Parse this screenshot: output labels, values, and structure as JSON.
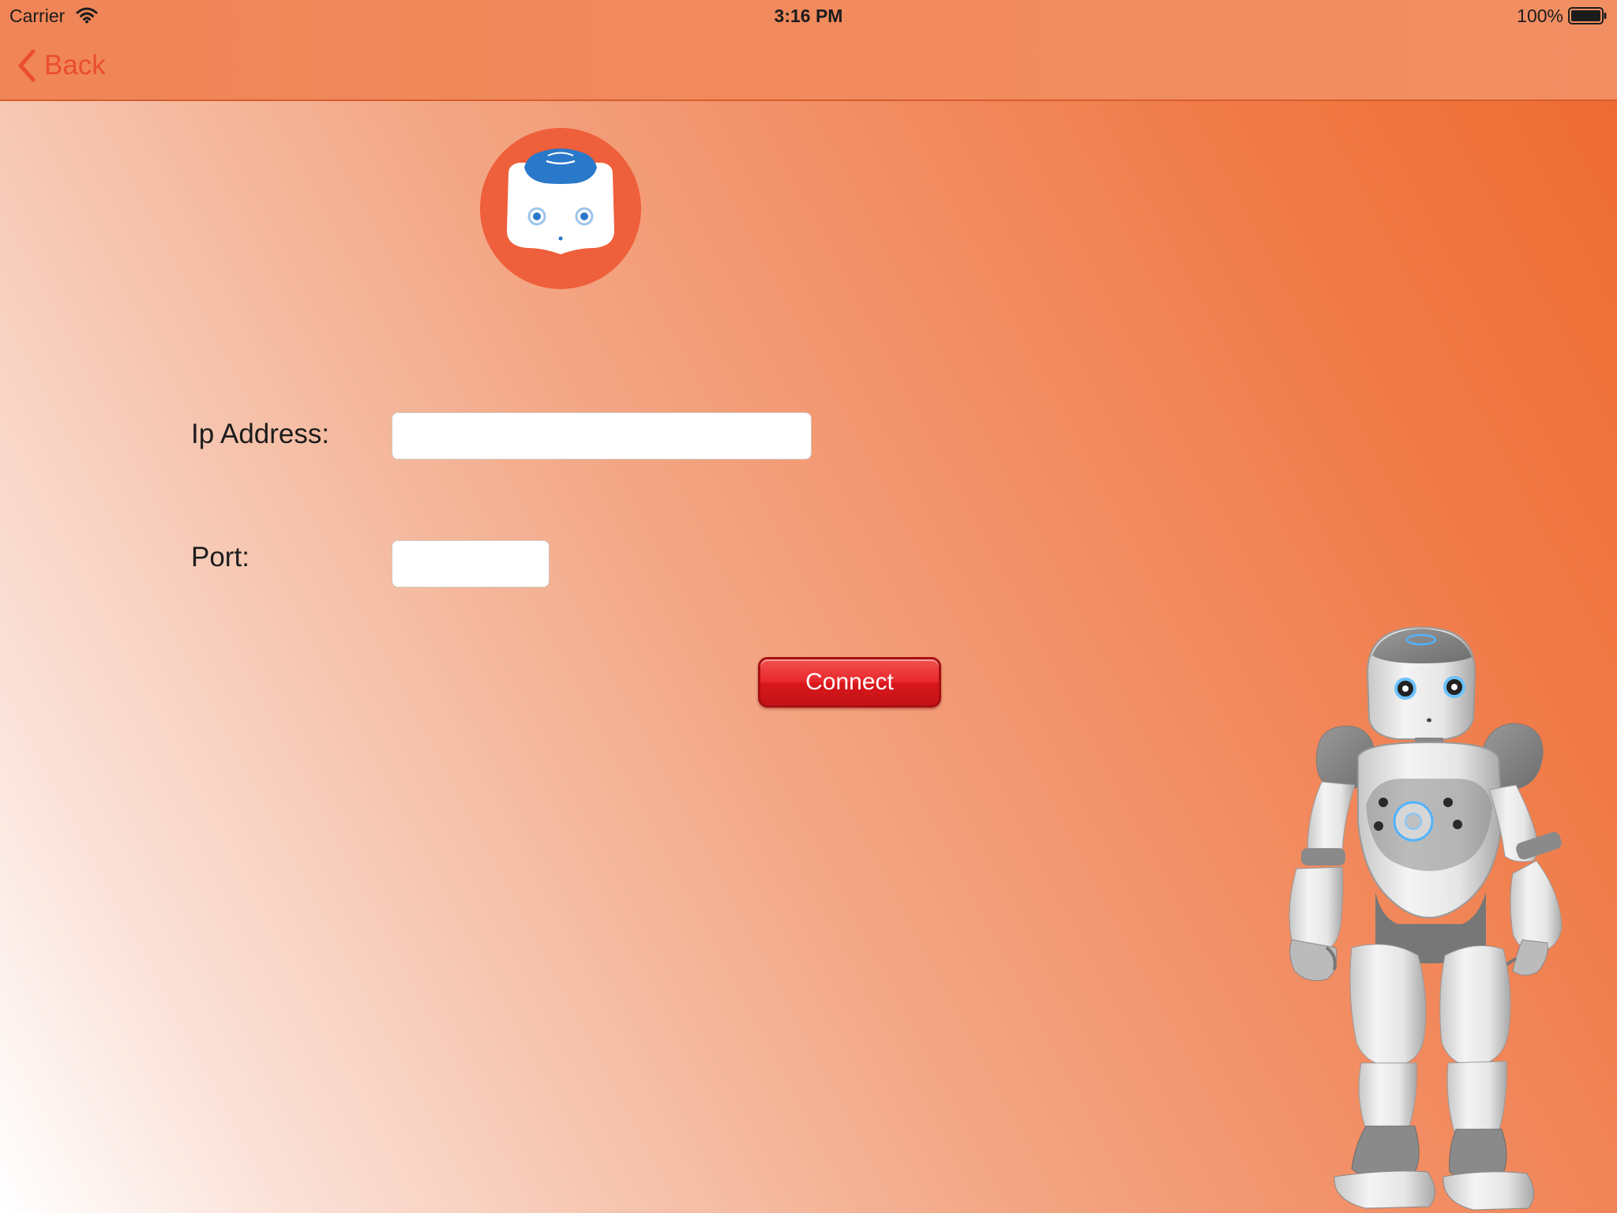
{
  "status_bar": {
    "carrier": "Carrier",
    "time": "3:16 PM",
    "battery": "100%"
  },
  "nav": {
    "back_label": "Back"
  },
  "form": {
    "ip_label": "Ip Address:",
    "ip_value": "",
    "port_label": "Port:",
    "port_value": "",
    "connect_label": "Connect"
  },
  "colors": {
    "accent": "#ea4e2b",
    "logo_circle": "#ee5f3b",
    "connect_button": "#e8282c"
  },
  "icons": {
    "back": "chevron-left-icon",
    "wifi": "wifi-icon",
    "battery": "battery-icon",
    "logo": "robot-head-logo",
    "robot": "humanoid-robot-illustration"
  }
}
